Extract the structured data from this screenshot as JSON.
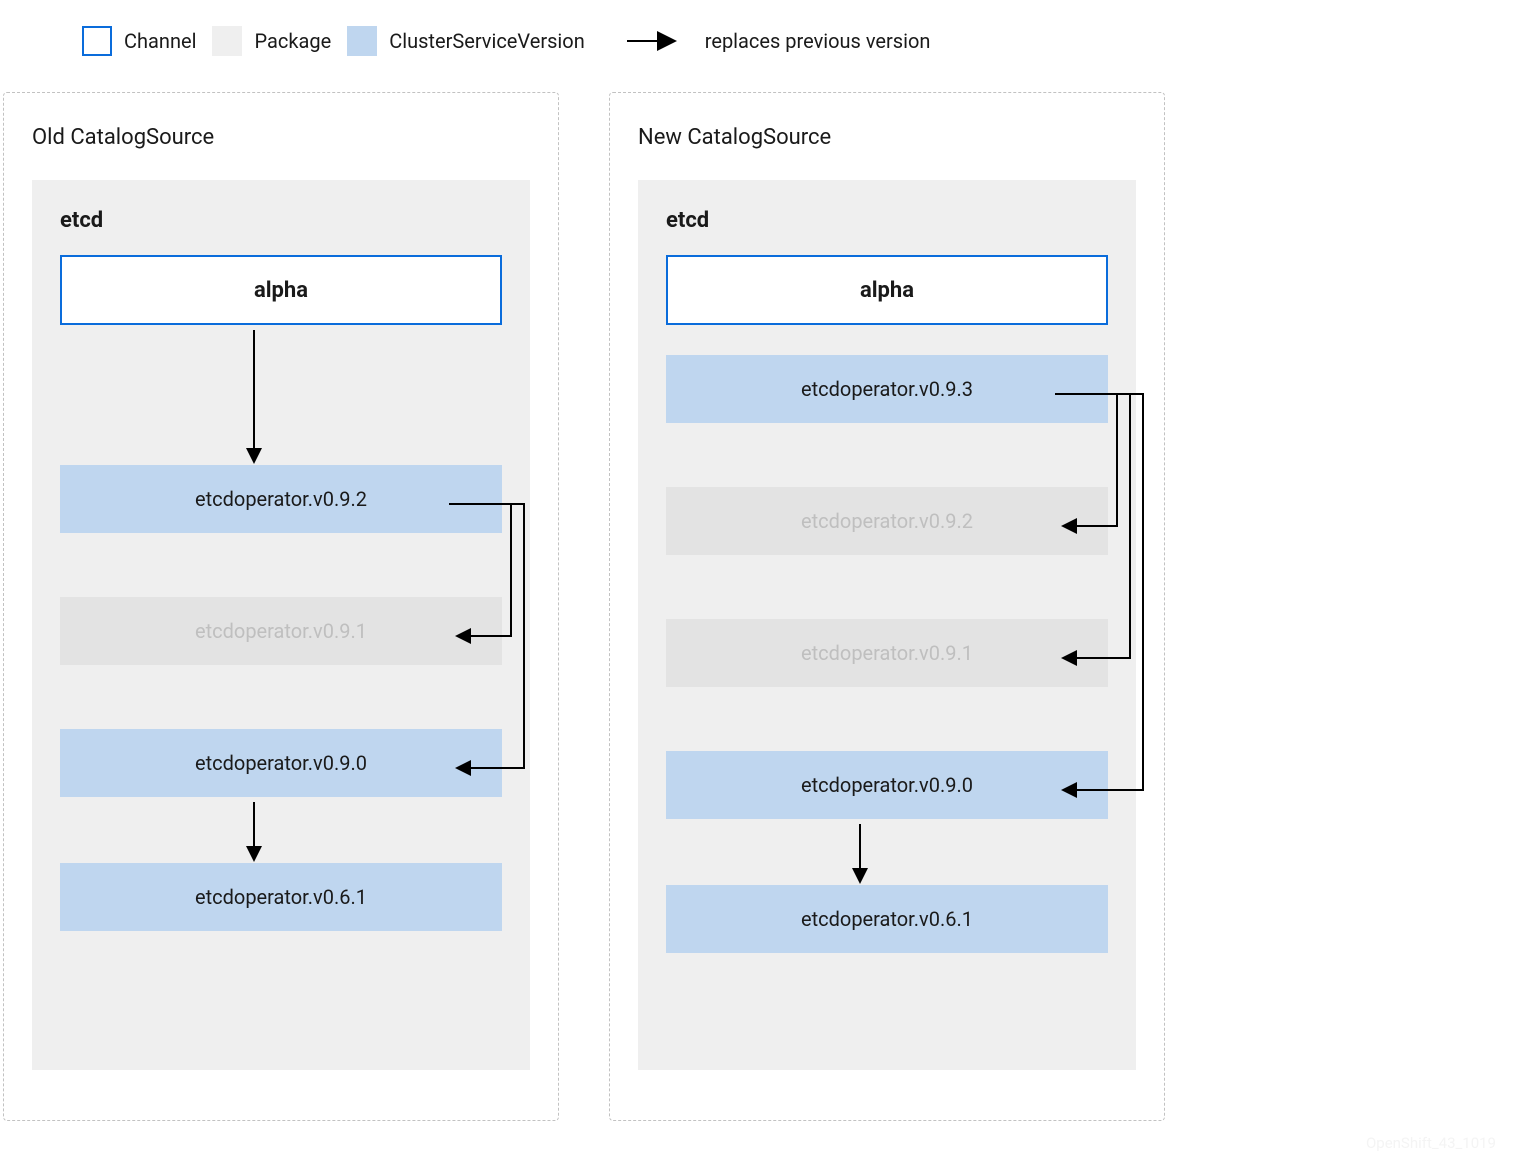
{
  "legend": {
    "channel": "Channel",
    "package": "Package",
    "csv": "ClusterServiceVersion",
    "replaces": "replaces previous version"
  },
  "left": {
    "title": "Old CatalogSource",
    "package": "etcd",
    "channel": "alpha",
    "v092": "etcdoperator.v0.9.2",
    "v091": "etcdoperator.v0.9.1",
    "v090": "etcdoperator.v0.9.0",
    "v061": "etcdoperator.v0.6.1"
  },
  "right": {
    "title": "New CatalogSource",
    "package": "etcd",
    "channel": "alpha",
    "v093": "etcdoperator.v0.9.3",
    "v092": "etcdoperator.v0.9.2",
    "v091": "etcdoperator.v0.9.1",
    "v090": "etcdoperator.v0.9.0",
    "v061": "etcdoperator.v0.6.1"
  },
  "watermark": "OpenShift_43_1019"
}
